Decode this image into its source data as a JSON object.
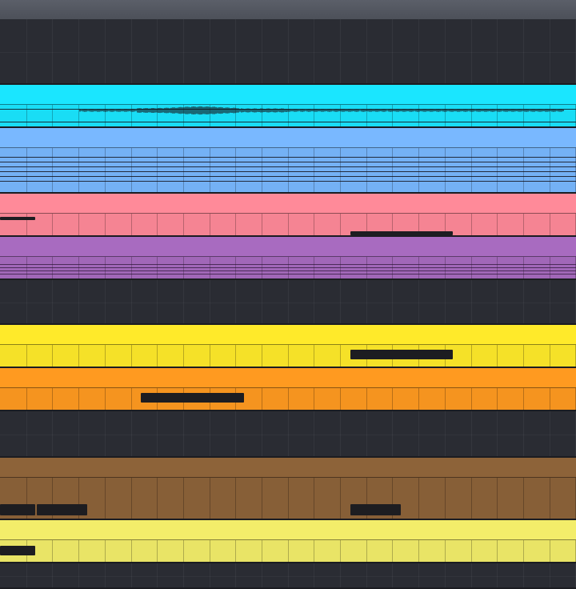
{
  "colors": {
    "background": "#2a2c33",
    "ruler": "#54575f",
    "note": "#1d1d21",
    "tracks": [
      "#1ae6ff",
      "#79b8ff",
      "#ff8a99",
      "#a86bc0",
      "#ffea2a",
      "#ff9a20",
      "#8d6339",
      "#f3ed6a"
    ]
  },
  "arranger": {
    "ruler_label": "",
    "tracks": [
      {
        "kind": "empty",
        "icon": "empty-track-icon"
      },
      {
        "kind": "audio",
        "color": "#1ae6ff",
        "icon": "waveform-icon"
      },
      {
        "kind": "midi",
        "color": "#79b8ff",
        "icon": "midi-clip-icon"
      },
      {
        "kind": "midi",
        "color": "#ff8a99",
        "icon": "midi-clip-icon"
      },
      {
        "kind": "midi",
        "color": "#a86bc0",
        "icon": "midi-clip-icon"
      },
      {
        "kind": "empty",
        "icon": "empty-track-icon"
      },
      {
        "kind": "midi",
        "color": "#ffea2a",
        "icon": "midi-clip-icon"
      },
      {
        "kind": "midi",
        "color": "#ff9a20",
        "icon": "midi-clip-icon"
      },
      {
        "kind": "empty",
        "icon": "empty-track-icon"
      },
      {
        "kind": "midi",
        "color": "#8d6339",
        "icon": "midi-clip-icon"
      },
      {
        "kind": "midi",
        "color": "#f3ed6a",
        "icon": "midi-clip-icon"
      },
      {
        "kind": "empty",
        "icon": "empty-track-icon"
      }
    ]
  }
}
